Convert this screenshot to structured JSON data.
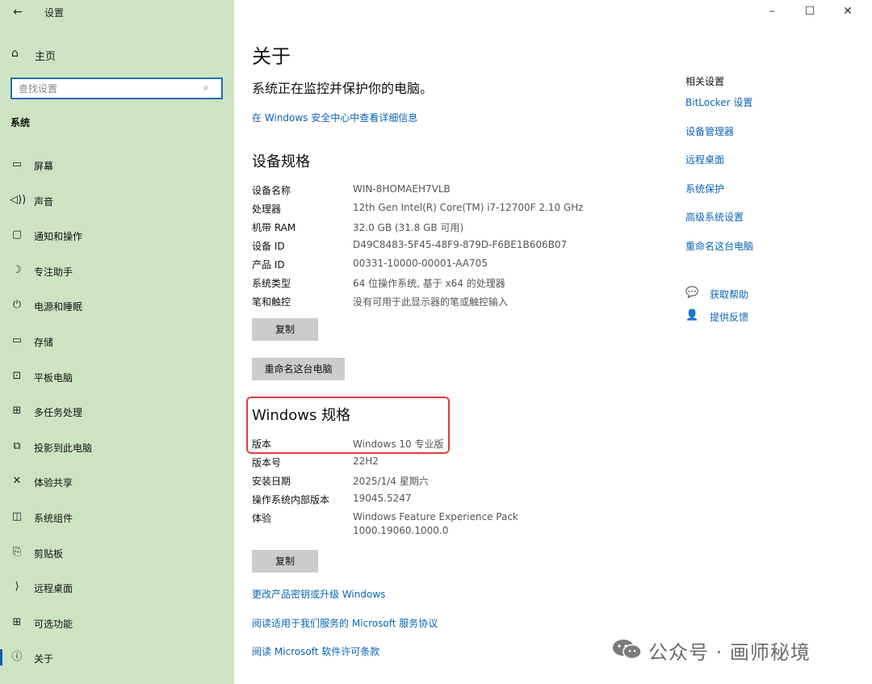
{
  "window": {
    "title": "设置",
    "minimize": "–",
    "maximize": "☐",
    "close": "✕"
  },
  "sidebar": {
    "home_label": "主页",
    "search_placeholder": "查找设置",
    "section_label": "系统",
    "items": [
      {
        "label": "屏幕",
        "icon": "monitor-icon",
        "glyph": "▭"
      },
      {
        "label": "声音",
        "icon": "speaker-icon",
        "glyph": "◁))"
      },
      {
        "label": "通知和操作",
        "icon": "notification-icon",
        "glyph": "▢"
      },
      {
        "label": "专注助手",
        "icon": "moon-icon",
        "glyph": "☽"
      },
      {
        "label": "电源和睡眠",
        "icon": "power-icon",
        "glyph": "⏻"
      },
      {
        "label": "存储",
        "icon": "storage-icon",
        "glyph": "▭"
      },
      {
        "label": "平板电脑",
        "icon": "tablet-icon",
        "glyph": "⊡"
      },
      {
        "label": "多任务处理",
        "icon": "multitask-icon",
        "glyph": "⊞"
      },
      {
        "label": "投影到此电脑",
        "icon": "project-icon",
        "glyph": "⧉"
      },
      {
        "label": "体验共享",
        "icon": "share-icon",
        "glyph": "✕"
      },
      {
        "label": "系统组件",
        "icon": "components-icon",
        "glyph": "◫"
      },
      {
        "label": "剪贴板",
        "icon": "clipboard-icon",
        "glyph": "⎘"
      },
      {
        "label": "远程桌面",
        "icon": "remote-icon",
        "glyph": "⟩"
      },
      {
        "label": "可选功能",
        "icon": "features-icon",
        "glyph": "⊞"
      },
      {
        "label": "关于",
        "icon": "info-icon",
        "glyph": "ⓘ"
      }
    ]
  },
  "main": {
    "title": "关于",
    "status_text": "系统正在监控并保护你的电脑。",
    "security_link": "在 Windows 安全中心中查看详细信息",
    "device_specs": {
      "title": "设备规格",
      "rows": [
        {
          "k": "设备名称",
          "v": "WIN-8HOMAEH7VLB"
        },
        {
          "k": "处理器",
          "v": "12th Gen Intel(R) Core(TM) i7-12700F   2.10 GHz"
        },
        {
          "k": "机带 RAM",
          "v": "32.0 GB (31.8 GB 可用)"
        },
        {
          "k": "设备 ID",
          "v": "D49C8483-5F45-48F9-879D-F6BE1B606B07"
        },
        {
          "k": "产品 ID",
          "v": "00331-10000-00001-AA705"
        },
        {
          "k": "系统类型",
          "v": "64 位操作系统, 基于 x64 的处理器"
        },
        {
          "k": "笔和触控",
          "v": "没有可用于此显示器的笔或触控输入"
        }
      ],
      "copy_button": "复制",
      "rename_button": "重命名这台电脑"
    },
    "windows_specs": {
      "title": "Windows 规格",
      "rows": [
        {
          "k": "版本",
          "v": "Windows 10 专业版"
        },
        {
          "k": "版本号",
          "v": "22H2"
        },
        {
          "k": "安装日期",
          "v": "2025/1/4 星期六"
        },
        {
          "k": "操作系统内部版本",
          "v": "19045.5247"
        },
        {
          "k": "体验",
          "v": "Windows Feature Experience Pack",
          "v2": "1000.19060.1000.0"
        }
      ],
      "copy_button": "复制"
    },
    "links": [
      "更改产品密钥或升级 Windows",
      "阅读适用于我们服务的 Microsoft 服务协议",
      "阅读 Microsoft 软件许可条款"
    ]
  },
  "related": {
    "header": "相关设置",
    "links": [
      "BitLocker 设置",
      "设备管理器",
      "远程桌面",
      "系统保护",
      "高级系统设置",
      "重命名这台电脑"
    ],
    "help": [
      {
        "label": "获取帮助",
        "icon": "help-icon"
      },
      {
        "label": "提供反馈",
        "icon": "feedback-icon"
      }
    ]
  },
  "watermark": {
    "text": "公众号 · 画师秘境"
  },
  "colors": {
    "sidebar_bg": "#cde4c3",
    "link": "#0b63b5",
    "highlight_border": "#e0403b",
    "button_bg": "#cccccc"
  }
}
